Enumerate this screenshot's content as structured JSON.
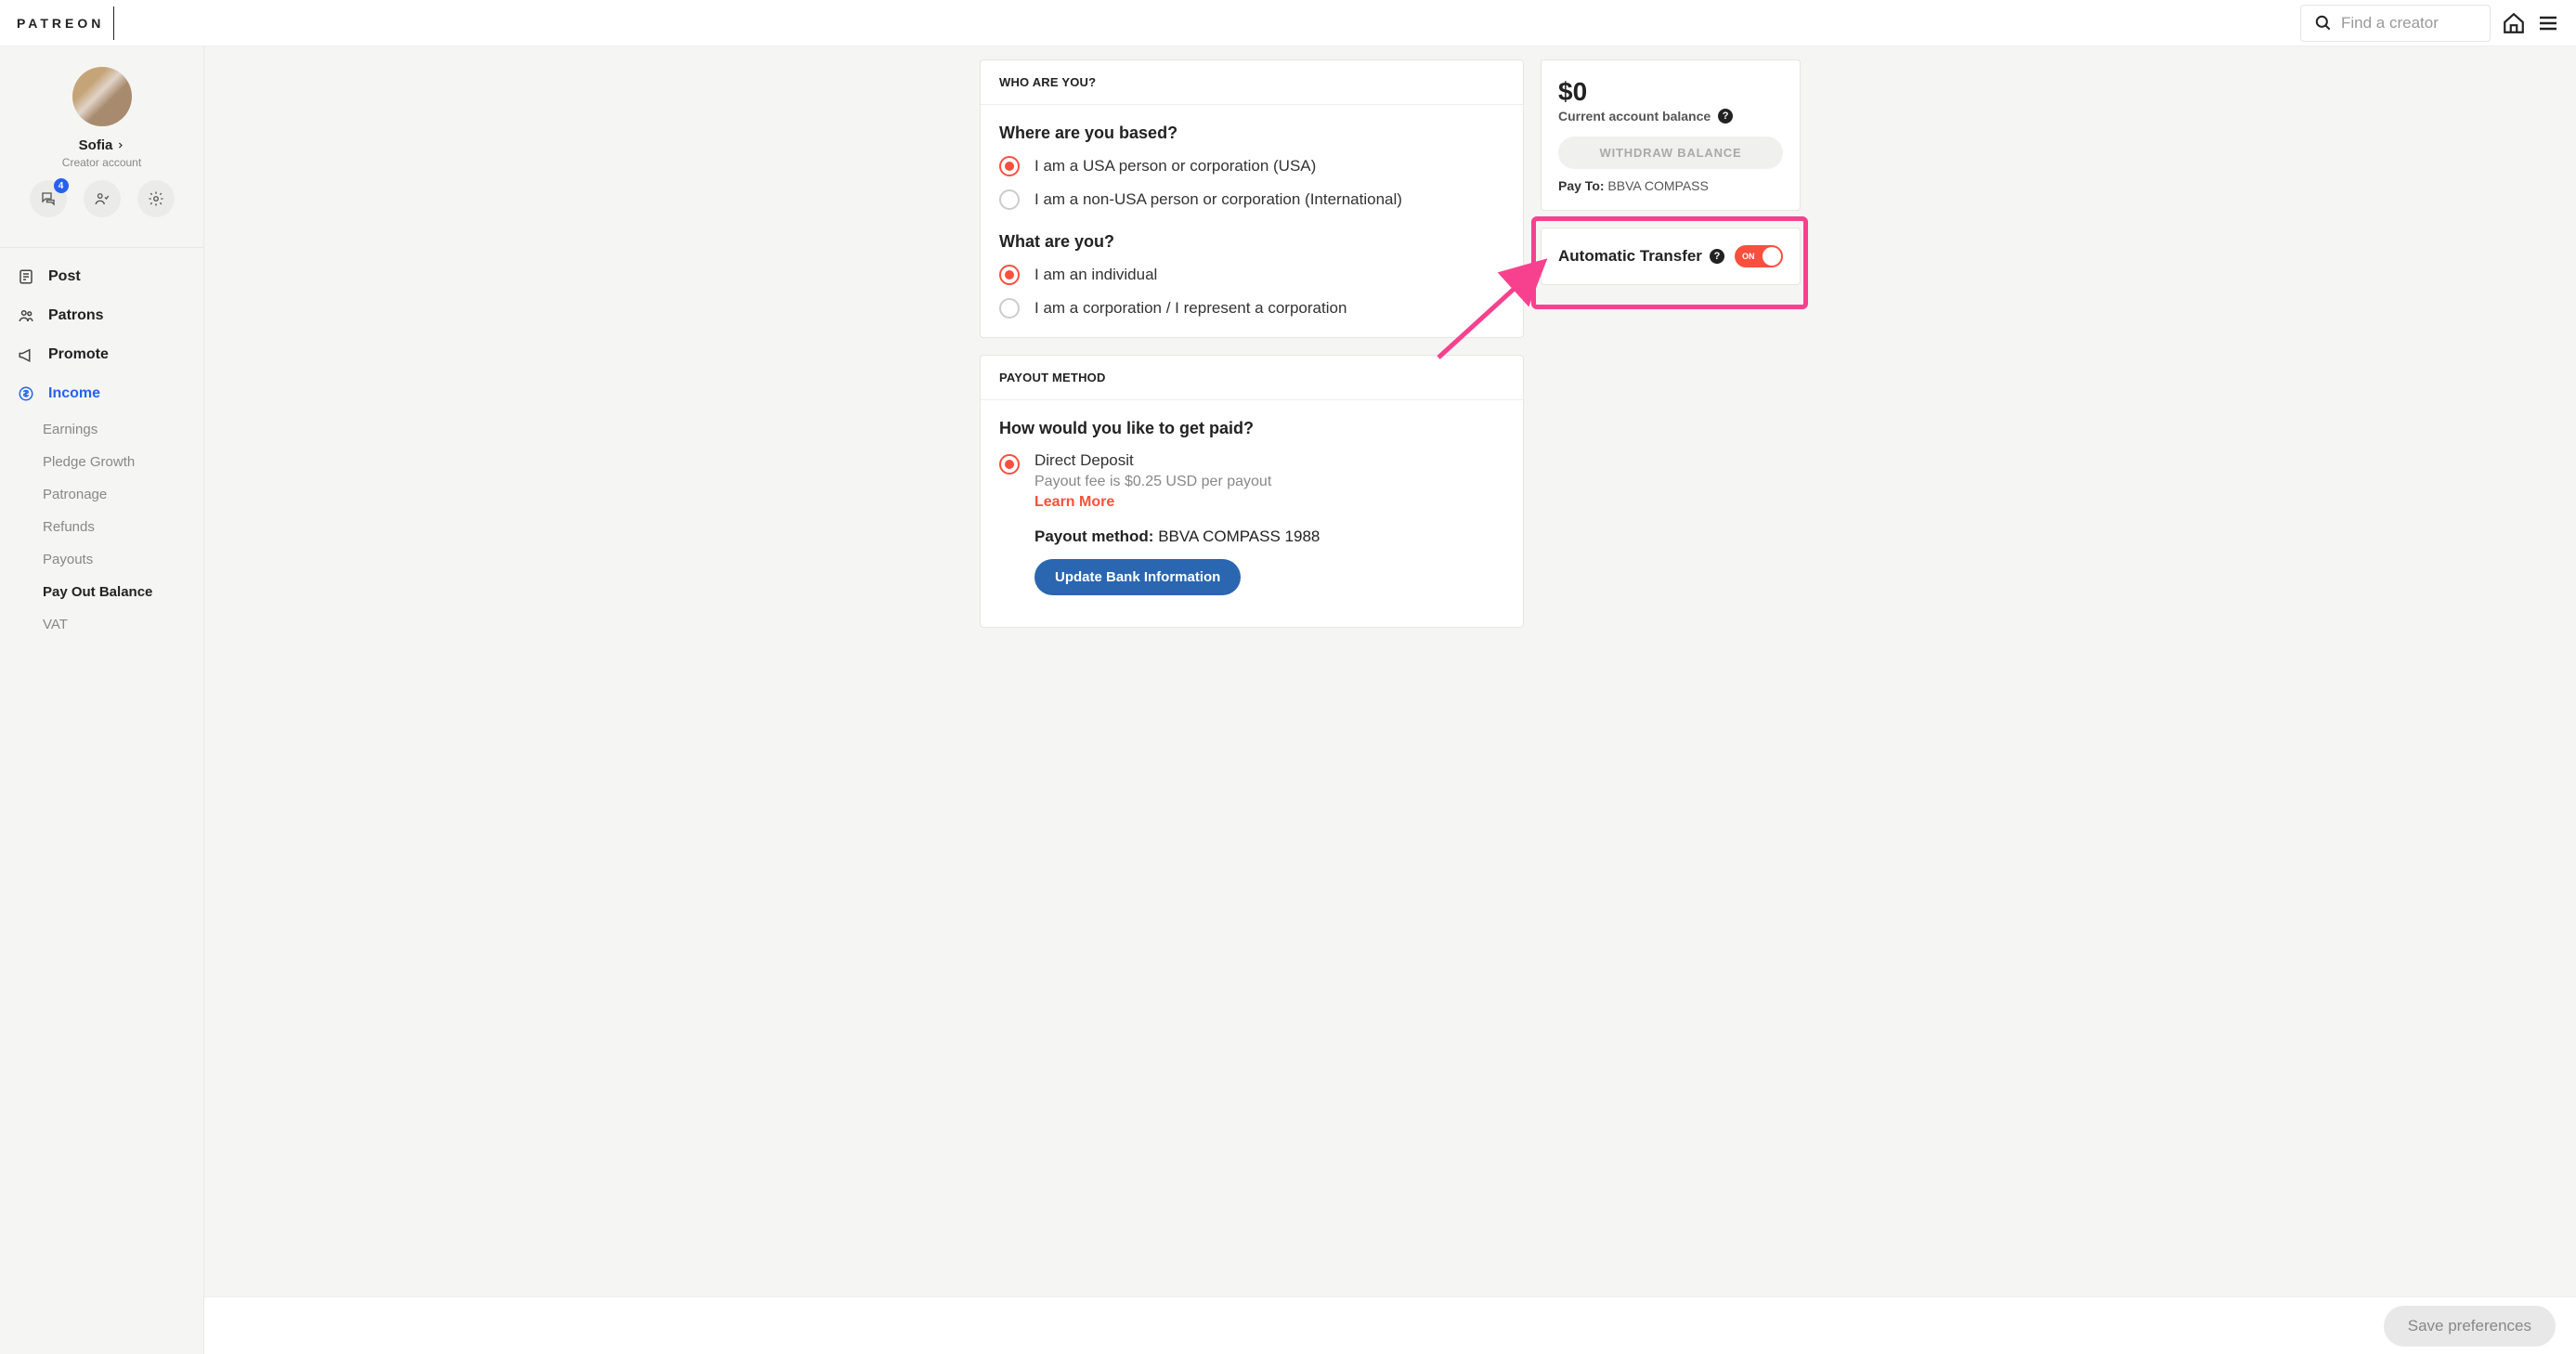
{
  "brand": "PATREON",
  "search": {
    "placeholder": "Find a creator"
  },
  "profile": {
    "name": "Sofia",
    "subtitle": "Creator account",
    "badge_count": "4"
  },
  "nav": {
    "items": [
      {
        "label": "Post"
      },
      {
        "label": "Patrons"
      },
      {
        "label": "Promote"
      },
      {
        "label": "Income"
      }
    ],
    "subnav": [
      {
        "label": "Earnings"
      },
      {
        "label": "Pledge Growth"
      },
      {
        "label": "Patronage"
      },
      {
        "label": "Refunds"
      },
      {
        "label": "Payouts"
      },
      {
        "label": "Pay Out Balance"
      },
      {
        "label": "VAT"
      }
    ]
  },
  "who": {
    "heading": "WHO ARE YOU?",
    "q1": "Where are you based?",
    "opt1a": "I am a USA person or corporation (USA)",
    "opt1b": "I am a non-USA person or corporation (International)",
    "q2": "What are you?",
    "opt2a": "I am an individual",
    "opt2b": "I am a corporation / I represent a corporation"
  },
  "payout": {
    "heading": "PAYOUT METHOD",
    "q": "How would you like to get paid?",
    "opt_label": "Direct Deposit",
    "fee": "Payout fee is $0.25 USD per payout",
    "learn_more": "Learn More",
    "method_label": "Payout method:",
    "method_value": "BBVA COMPASS 1988",
    "update_btn": "Update Bank Information"
  },
  "balance": {
    "amount": "$0",
    "label": "Current account balance",
    "withdraw": "WITHDRAW BALANCE",
    "payto_label": "Pay To:",
    "payto_value": "BBVA COMPASS"
  },
  "auto_transfer": {
    "label": "Automatic Transfer",
    "state": "ON"
  },
  "footer": {
    "save": "Save preferences"
  }
}
